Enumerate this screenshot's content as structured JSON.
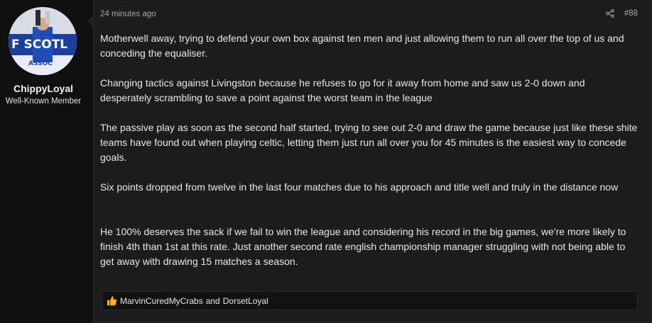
{
  "user": {
    "username": "ChippyLoyal",
    "title": "Well-Known Member",
    "avatar_banner_text": "F SCOTL",
    "avatar_lower_text": "ASSOC"
  },
  "post": {
    "time": "24 minutes ago",
    "number": "#88",
    "paragraphs": [
      "Motherwell away, trying to defend your own box against ten men and just allowing them to run all over the top of us and conceding the equaliser.",
      "Changing tactics against Livingston because he refuses to go for it away from home and saw us 2-0 down and desperately scrambling to save a point against the worst team in the league",
      "The passive play as soon as the second half started, trying to see out 2-0 and draw the game because just like these shite teams have found out when playing celtic, letting them just run all over you for 45 minutes is the easiest way to concede goals.",
      "Six points dropped from twelve in the last four matches due to his approach and title well and truly in the distance now",
      "He 100% deserves the sack if we fail to win the league and considering his record in the big games, we're more likely to finish 4th than 1st at this rate. Just another second rate english championship manager struggling with not being able to get away with drawing 15 matches a season."
    ]
  },
  "reactions": {
    "icon": "thumbs-up-icon",
    "user1": "MarvinCuredMyCrabs",
    "conjunction": "and",
    "user2": "DorsetLoyal"
  },
  "icons": {
    "share": "share-icon",
    "like": "thumbs-up-icon"
  },
  "colors": {
    "page_bg": "#101010",
    "message_bg": "#1c1c1c",
    "text": "#e8e8e8",
    "meta_text": "#a8a8a8",
    "like_yellow": "#f5b90a"
  }
}
